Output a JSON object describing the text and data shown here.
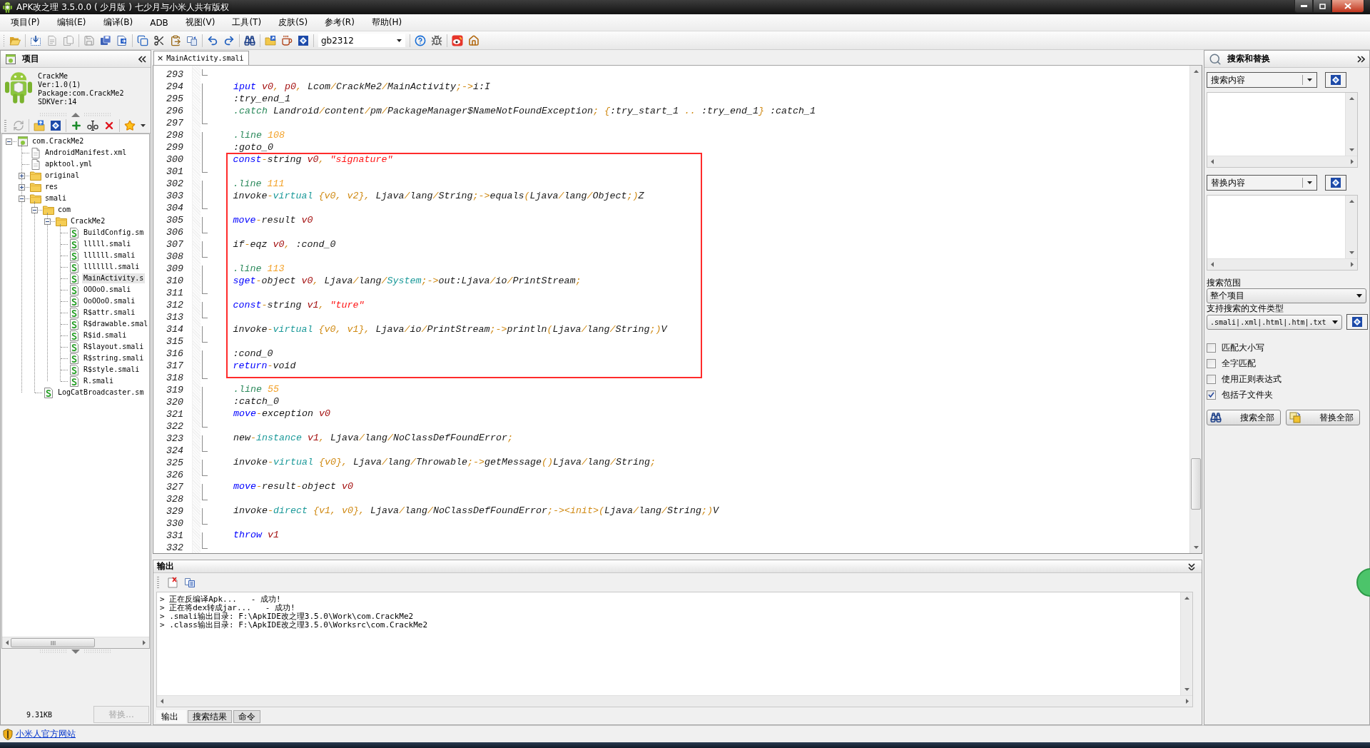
{
  "window": {
    "title": "APK改之理 3.5.0.0 ( 少月版 ) 七少月与小米人共有版权"
  },
  "menu": [
    "项目(P)",
    "编辑(E)",
    "编译(B)",
    "ADB",
    "视图(V)",
    "工具(T)",
    "皮肤(S)",
    "参考(R)",
    "帮助(H)"
  ],
  "toolbar": {
    "groups": [
      [
        {
          "kind": "open",
          "disabled": false
        }
      ],
      [
        {
          "kind": "import",
          "disabled": false
        },
        {
          "kind": "page",
          "disabled": true
        },
        {
          "kind": "pages",
          "disabled": true
        }
      ],
      [
        {
          "kind": "save",
          "disabled": true
        },
        {
          "kind": "save-all",
          "disabled": false
        },
        {
          "kind": "export",
          "disabled": false
        }
      ],
      [
        {
          "kind": "copy",
          "disabled": false
        },
        {
          "kind": "cut",
          "disabled": false
        },
        {
          "kind": "paste",
          "disabled": false
        },
        {
          "kind": "replace",
          "disabled": false
        }
      ],
      [
        {
          "kind": "undo",
          "disabled": false
        },
        {
          "kind": "redo",
          "disabled": false
        }
      ],
      [
        {
          "kind": "find",
          "disabled": false
        }
      ],
      [
        {
          "kind": "open-project",
          "disabled": false
        },
        {
          "kind": "java",
          "disabled": false
        },
        {
          "kind": "sign",
          "disabled": false
        }
      ],
      [
        {
          "kind": "combo",
          "value": "gb2312",
          "disabled": false
        }
      ],
      [
        {
          "kind": "help",
          "disabled": false
        },
        {
          "kind": "bug",
          "disabled": false
        }
      ],
      [
        {
          "kind": "weibo",
          "disabled": false
        },
        {
          "kind": "home",
          "disabled": false
        }
      ]
    ]
  },
  "project_panel": {
    "title": "项目",
    "app": {
      "name": "CrackMe",
      "version": "Ver:1.0(1)",
      "package": "Package:com.CrackMe2",
      "sdk": "SDKVer:14"
    },
    "tools": [
      [
        {
          "kind": "refresh",
          "disabled": true
        }
      ],
      [
        {
          "kind": "import-folder",
          "disabled": false
        },
        {
          "kind": "sign",
          "disabled": false
        }
      ],
      [
        {
          "kind": "add",
          "disabled": false
        },
        {
          "kind": "rename",
          "disabled": false
        },
        {
          "kind": "delete",
          "disabled": false
        }
      ],
      [
        {
          "kind": "star",
          "disabled": false
        }
      ]
    ],
    "tree": [
      {
        "label": "com.CrackMe2",
        "kind": "project",
        "expanded": true,
        "selected": false,
        "children": [
          {
            "label": "AndroidManifest.xml",
            "kind": "file",
            "selected": false
          },
          {
            "label": "apktool.yml",
            "kind": "file",
            "selected": false
          },
          {
            "label": "original",
            "kind": "folder",
            "expanded": false,
            "selected": false
          },
          {
            "label": "res",
            "kind": "folder",
            "expanded": false,
            "selected": false
          },
          {
            "label": "smali",
            "kind": "folder",
            "expanded": true,
            "selected": false,
            "children": [
              {
                "label": "com",
                "kind": "folder",
                "expanded": true,
                "selected": false,
                "children": [
                  {
                    "label": "CrackMe2",
                    "kind": "folder",
                    "expanded": true,
                    "selected": false,
                    "children": [
                      {
                        "label": "BuildConfig.sm",
                        "kind": "smali",
                        "selected": false
                      },
                      {
                        "label": "lllll.smali",
                        "kind": "smali",
                        "selected": false
                      },
                      {
                        "label": "llllll.smali",
                        "kind": "smali",
                        "selected": false
                      },
                      {
                        "label": "lllllll.smali",
                        "kind": "smali",
                        "selected": false
                      },
                      {
                        "label": "MainActivity.s",
                        "kind": "smali",
                        "selected": true
                      },
                      {
                        "label": "OOOoO.smali",
                        "kind": "smali",
                        "selected": false
                      },
                      {
                        "label": "OoOOoO.smali",
                        "kind": "smali",
                        "selected": false
                      },
                      {
                        "label": "R$attr.smali",
                        "kind": "smali",
                        "selected": false
                      },
                      {
                        "label": "R$drawable.smal",
                        "kind": "smali",
                        "selected": false
                      },
                      {
                        "label": "R$id.smali",
                        "kind": "smali",
                        "selected": false
                      },
                      {
                        "label": "R$layout.smali",
                        "kind": "smali",
                        "selected": false
                      },
                      {
                        "label": "R$string.smali",
                        "kind": "smali",
                        "selected": false
                      },
                      {
                        "label": "R$style.smali",
                        "kind": "smali",
                        "selected": false
                      },
                      {
                        "label": "R.smali",
                        "kind": "smali",
                        "selected": false
                      }
                    ]
                  }
                ]
              },
              {
                "label": "LogCatBroadcaster.sm",
                "kind": "smali",
                "selected": false
              }
            ]
          }
        ]
      }
    ],
    "size": "9.31KB",
    "replace_button": {
      "label": "替换...",
      "disabled": true
    }
  },
  "editor": {
    "tab": {
      "close": "×",
      "label": "MainActivity.smali",
      "selected": true
    },
    "lines": [
      {
        "number": "293",
        "boxed": false
      },
      {
        "number": "294",
        "boxed": false,
        "tokens": [
          {
            "kind": "kw",
            "text": "iput "
          },
          {
            "kind": "reg",
            "text": "v0"
          },
          {
            "kind": "op",
            "text": ", "
          },
          {
            "kind": "reg",
            "text": "p0"
          },
          {
            "kind": "op",
            "text": ", "
          },
          {
            "kind": "txt",
            "text": "Lcom"
          },
          {
            "kind": "op",
            "text": "/"
          },
          {
            "kind": "txt",
            "text": "CrackMe2"
          },
          {
            "kind": "op",
            "text": "/"
          },
          {
            "kind": "txt",
            "text": "MainActivity"
          },
          {
            "kind": "op",
            "text": ";->"
          },
          {
            "kind": "txt",
            "text": "i:I"
          }
        ]
      },
      {
        "number": "295",
        "boxed": false,
        "tokens": [
          {
            "kind": "txt",
            "text": ":try_end_1"
          }
        ]
      },
      {
        "number": "296",
        "boxed": false,
        "tokens": [
          {
            "kind": "dir",
            "text": ".catch "
          },
          {
            "kind": "txt",
            "text": "Landroid"
          },
          {
            "kind": "op",
            "text": "/"
          },
          {
            "kind": "txt",
            "text": "content"
          },
          {
            "kind": "op",
            "text": "/"
          },
          {
            "kind": "txt",
            "text": "pm"
          },
          {
            "kind": "op",
            "text": "/"
          },
          {
            "kind": "txt",
            "text": "PackageManager$NameNotFoundException"
          },
          {
            "kind": "op",
            "text": "; {"
          },
          {
            "kind": "txt",
            "text": ":try_start_1"
          },
          {
            "kind": "op",
            "text": " .. "
          },
          {
            "kind": "txt",
            "text": ":try_end_1"
          },
          {
            "kind": "op",
            "text": "} "
          },
          {
            "kind": "txt",
            "text": ":catch_1"
          }
        ]
      },
      {
        "number": "297",
        "boxed": false
      },
      {
        "number": "298",
        "boxed": false,
        "tokens": [
          {
            "kind": "dir",
            "text": ".line "
          },
          {
            "kind": "num",
            "text": "108"
          }
        ]
      },
      {
        "number": "299",
        "boxed": false,
        "tokens": [
          {
            "kind": "txt",
            "text": ":goto_0"
          }
        ]
      },
      {
        "number": "300",
        "boxed": true,
        "tokens": [
          {
            "kind": "kw",
            "text": "const"
          },
          {
            "kind": "op",
            "text": "-"
          },
          {
            "kind": "txt",
            "text": "string "
          },
          {
            "kind": "reg",
            "text": "v0"
          },
          {
            "kind": "op",
            "text": ", "
          },
          {
            "kind": "str",
            "text": "\"signature\""
          }
        ]
      },
      {
        "number": "301",
        "boxed": true
      },
      {
        "number": "302",
        "boxed": true,
        "tokens": [
          {
            "kind": "dir",
            "text": ".line "
          },
          {
            "kind": "num",
            "text": "111"
          }
        ]
      },
      {
        "number": "303",
        "boxed": true,
        "tokens": [
          {
            "kind": "txt",
            "text": "invoke"
          },
          {
            "kind": "op",
            "text": "-"
          },
          {
            "kind": "cls",
            "text": "virtual "
          },
          {
            "kind": "op",
            "text": "{v0, v2}, "
          },
          {
            "kind": "txt",
            "text": "Ljava"
          },
          {
            "kind": "op",
            "text": "/"
          },
          {
            "kind": "txt",
            "text": "lang"
          },
          {
            "kind": "op",
            "text": "/"
          },
          {
            "kind": "txt",
            "text": "String"
          },
          {
            "kind": "op",
            "text": ";->"
          },
          {
            "kind": "txt",
            "text": "equals"
          },
          {
            "kind": "op",
            "text": "("
          },
          {
            "kind": "txt",
            "text": "Ljava"
          },
          {
            "kind": "op",
            "text": "/"
          },
          {
            "kind": "txt",
            "text": "lang"
          },
          {
            "kind": "op",
            "text": "/"
          },
          {
            "kind": "txt",
            "text": "Object"
          },
          {
            "kind": "op",
            "text": ";)"
          },
          {
            "kind": "txt",
            "text": "Z"
          }
        ]
      },
      {
        "number": "304",
        "boxed": true
      },
      {
        "number": "305",
        "boxed": true,
        "tokens": [
          {
            "kind": "kw",
            "text": "move"
          },
          {
            "kind": "op",
            "text": "-"
          },
          {
            "kind": "txt",
            "text": "result "
          },
          {
            "kind": "reg",
            "text": "v0"
          }
        ]
      },
      {
        "number": "306",
        "boxed": true
      },
      {
        "number": "307",
        "boxed": true,
        "tokens": [
          {
            "kind": "txt",
            "text": "if"
          },
          {
            "kind": "op",
            "text": "-"
          },
          {
            "kind": "txt",
            "text": "eqz "
          },
          {
            "kind": "reg",
            "text": "v0"
          },
          {
            "kind": "op",
            "text": ", "
          },
          {
            "kind": "txt",
            "text": ":cond_0"
          }
        ]
      },
      {
        "number": "308",
        "boxed": true
      },
      {
        "number": "309",
        "boxed": true,
        "tokens": [
          {
            "kind": "dir",
            "text": ".line "
          },
          {
            "kind": "num",
            "text": "113"
          }
        ]
      },
      {
        "number": "310",
        "boxed": true,
        "tokens": [
          {
            "kind": "kw",
            "text": "sget"
          },
          {
            "kind": "op",
            "text": "-"
          },
          {
            "kind": "txt",
            "text": "object "
          },
          {
            "kind": "reg",
            "text": "v0"
          },
          {
            "kind": "op",
            "text": ", "
          },
          {
            "kind": "txt",
            "text": "Ljava"
          },
          {
            "kind": "op",
            "text": "/"
          },
          {
            "kind": "txt",
            "text": "lang"
          },
          {
            "kind": "op",
            "text": "/"
          },
          {
            "kind": "cls",
            "text": "System"
          },
          {
            "kind": "op",
            "text": ";->"
          },
          {
            "kind": "txt",
            "text": "out:Ljava"
          },
          {
            "kind": "op",
            "text": "/"
          },
          {
            "kind": "txt",
            "text": "io"
          },
          {
            "kind": "op",
            "text": "/"
          },
          {
            "kind": "txt",
            "text": "PrintStream"
          },
          {
            "kind": "op",
            "text": ";"
          }
        ]
      },
      {
        "number": "311",
        "boxed": true
      },
      {
        "number": "312",
        "boxed": true,
        "tokens": [
          {
            "kind": "kw",
            "text": "const"
          },
          {
            "kind": "op",
            "text": "-"
          },
          {
            "kind": "txt",
            "text": "string "
          },
          {
            "kind": "reg",
            "text": "v1"
          },
          {
            "kind": "op",
            "text": ", "
          },
          {
            "kind": "str",
            "text": "\"ture\""
          }
        ]
      },
      {
        "number": "313",
        "boxed": true
      },
      {
        "number": "314",
        "boxed": true,
        "tokens": [
          {
            "kind": "txt",
            "text": "invoke"
          },
          {
            "kind": "op",
            "text": "-"
          },
          {
            "kind": "cls",
            "text": "virtual "
          },
          {
            "kind": "op",
            "text": "{v0, v1}, "
          },
          {
            "kind": "txt",
            "text": "Ljava"
          },
          {
            "kind": "op",
            "text": "/"
          },
          {
            "kind": "txt",
            "text": "io"
          },
          {
            "kind": "op",
            "text": "/"
          },
          {
            "kind": "txt",
            "text": "PrintStream"
          },
          {
            "kind": "op",
            "text": ";->"
          },
          {
            "kind": "txt",
            "text": "println"
          },
          {
            "kind": "op",
            "text": "("
          },
          {
            "kind": "txt",
            "text": "Ljava"
          },
          {
            "kind": "op",
            "text": "/"
          },
          {
            "kind": "txt",
            "text": "lang"
          },
          {
            "kind": "op",
            "text": "/"
          },
          {
            "kind": "txt",
            "text": "String"
          },
          {
            "kind": "op",
            "text": ";)"
          },
          {
            "kind": "txt",
            "text": "V"
          }
        ]
      },
      {
        "number": "315",
        "boxed": true
      },
      {
        "number": "316",
        "boxed": true,
        "tokens": [
          {
            "kind": "txt",
            "text": ":cond_0"
          }
        ]
      },
      {
        "number": "317",
        "boxed": true,
        "tokens": [
          {
            "kind": "kw",
            "text": "return"
          },
          {
            "kind": "op",
            "text": "-"
          },
          {
            "kind": "txt",
            "text": "void"
          }
        ]
      },
      {
        "number": "318",
        "boxed": false
      },
      {
        "number": "319",
        "boxed": false,
        "tokens": [
          {
            "kind": "dir",
            "text": ".line "
          },
          {
            "kind": "num",
            "text": "55"
          }
        ]
      },
      {
        "number": "320",
        "boxed": false,
        "tokens": [
          {
            "kind": "txt",
            "text": ":catch_0"
          }
        ]
      },
      {
        "number": "321",
        "boxed": false,
        "tokens": [
          {
            "kind": "kw",
            "text": "move"
          },
          {
            "kind": "op",
            "text": "-"
          },
          {
            "kind": "txt",
            "text": "exception "
          },
          {
            "kind": "reg",
            "text": "v0"
          }
        ]
      },
      {
        "number": "322",
        "boxed": false
      },
      {
        "number": "323",
        "boxed": false,
        "tokens": [
          {
            "kind": "txt",
            "text": "new"
          },
          {
            "kind": "op",
            "text": "-"
          },
          {
            "kind": "cls",
            "text": "instance "
          },
          {
            "kind": "reg",
            "text": "v1"
          },
          {
            "kind": "op",
            "text": ", "
          },
          {
            "kind": "txt",
            "text": "Ljava"
          },
          {
            "kind": "op",
            "text": "/"
          },
          {
            "kind": "txt",
            "text": "lang"
          },
          {
            "kind": "op",
            "text": "/"
          },
          {
            "kind": "txt",
            "text": "NoClassDefFoundError"
          },
          {
            "kind": "op",
            "text": ";"
          }
        ]
      },
      {
        "number": "324",
        "boxed": false
      },
      {
        "number": "325",
        "boxed": false,
        "tokens": [
          {
            "kind": "txt",
            "text": "invoke"
          },
          {
            "kind": "op",
            "text": "-"
          },
          {
            "kind": "cls",
            "text": "virtual "
          },
          {
            "kind": "op",
            "text": "{v0}, "
          },
          {
            "kind": "txt",
            "text": "Ljava"
          },
          {
            "kind": "op",
            "text": "/"
          },
          {
            "kind": "txt",
            "text": "lang"
          },
          {
            "kind": "op",
            "text": "/"
          },
          {
            "kind": "txt",
            "text": "Throwable"
          },
          {
            "kind": "op",
            "text": ";->"
          },
          {
            "kind": "txt",
            "text": "getMessage"
          },
          {
            "kind": "op",
            "text": "()"
          },
          {
            "kind": "txt",
            "text": "Ljava"
          },
          {
            "kind": "op",
            "text": "/"
          },
          {
            "kind": "txt",
            "text": "lang"
          },
          {
            "kind": "op",
            "text": "/"
          },
          {
            "kind": "txt",
            "text": "String"
          },
          {
            "kind": "op",
            "text": ";"
          }
        ]
      },
      {
        "number": "326",
        "boxed": false
      },
      {
        "number": "327",
        "boxed": false,
        "tokens": [
          {
            "kind": "kw",
            "text": "move"
          },
          {
            "kind": "op",
            "text": "-"
          },
          {
            "kind": "txt",
            "text": "result"
          },
          {
            "kind": "op",
            "text": "-"
          },
          {
            "kind": "txt",
            "text": "object "
          },
          {
            "kind": "reg",
            "text": "v0"
          }
        ]
      },
      {
        "number": "328",
        "boxed": false
      },
      {
        "number": "329",
        "boxed": false,
        "tokens": [
          {
            "kind": "txt",
            "text": "invoke"
          },
          {
            "kind": "op",
            "text": "-"
          },
          {
            "kind": "cls",
            "text": "direct "
          },
          {
            "kind": "op",
            "text": "{v1, v0}, "
          },
          {
            "kind": "txt",
            "text": "Ljava"
          },
          {
            "kind": "op",
            "text": "/"
          },
          {
            "kind": "txt",
            "text": "lang"
          },
          {
            "kind": "op",
            "text": "/"
          },
          {
            "kind": "txt",
            "text": "NoClassDefFoundError"
          },
          {
            "kind": "op",
            "text": ";-><init>("
          },
          {
            "kind": "txt",
            "text": "Ljava"
          },
          {
            "kind": "op",
            "text": "/"
          },
          {
            "kind": "txt",
            "text": "lang"
          },
          {
            "kind": "op",
            "text": "/"
          },
          {
            "kind": "txt",
            "text": "String"
          },
          {
            "kind": "op",
            "text": ";)"
          },
          {
            "kind": "txt",
            "text": "V"
          }
        ]
      },
      {
        "number": "330",
        "boxed": false
      },
      {
        "number": "331",
        "boxed": false,
        "tokens": [
          {
            "kind": "kw",
            "text": "throw "
          },
          {
            "kind": "reg",
            "text": "v1"
          }
        ]
      },
      {
        "number": "332",
        "boxed": false
      }
    ]
  },
  "output": {
    "title": "输出",
    "lines": [
      "> 正在反编译Apk...   - 成功!",
      "> 正在将dex转成jar...   - 成功!",
      "> .smali输出目录: F:\\ApkIDE改之理3.5.0\\Work\\com.CrackMe2",
      "> .class输出目录: F:\\ApkIDE改之理3.5.0\\Worksrc\\com.CrackMe2"
    ],
    "tabs": [
      {
        "label": "输出",
        "selected": true
      },
      {
        "label": "搜索结果",
        "selected": false
      },
      {
        "label": "命令",
        "selected": false
      }
    ]
  },
  "search_panel": {
    "title": "搜索和替换",
    "search": {
      "value": "搜索内容"
    },
    "replace": {
      "value": "替换内容"
    },
    "scope_label": "搜索范围",
    "scope": "整个项目",
    "types_label": "支持搜索的文件类型",
    "types": ".smali|.xml|.html|.htm|.txt",
    "options": [
      {
        "label": "匹配大小写",
        "checked": false
      },
      {
        "label": "全字匹配",
        "checked": false
      },
      {
        "label": "使用正则表达式",
        "checked": false
      },
      {
        "label": "包括子文件夹",
        "checked": true
      }
    ],
    "buttons": [
      {
        "kind": "search",
        "label": "搜索全部"
      },
      {
        "kind": "replace",
        "label": "替换全部"
      }
    ]
  },
  "status_bar": {
    "link": "小米人官方网站"
  }
}
